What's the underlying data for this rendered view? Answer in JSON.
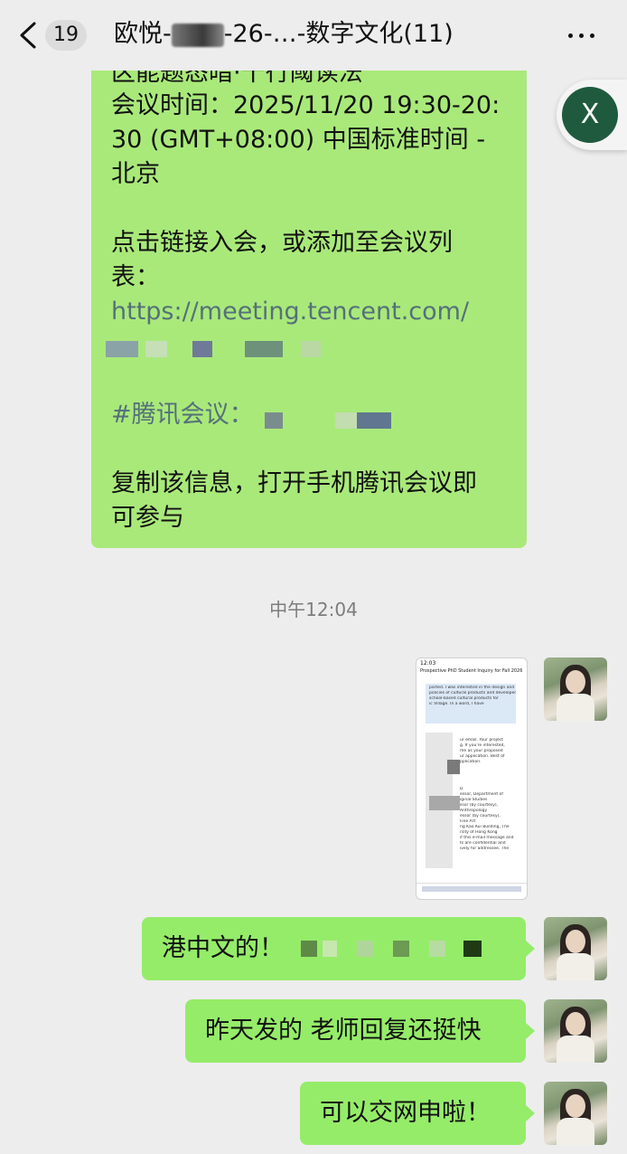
{
  "header": {
    "unread_count": "19",
    "title_prefix": "欧悦-",
    "title_suffix": "-26-…-数字文化(11)",
    "back_icon": "chevron-left-icon",
    "more_icon": "more-dots-icon"
  },
  "floating_close": {
    "label": "X"
  },
  "meeting_message": {
    "line_cut": "区能题态暗·十行阈读法",
    "line1": "会议时间：2025/11/20 19:30-20:",
    "line2": "30 (GMT+08:00) 中国标准时间 -",
    "line3": "北京",
    "line4": "点击链接入会，或添加至会议列",
    "line5": "表：",
    "link": "https://meeting.tencent.com/",
    "hashtag": "#腾讯会议：",
    "line6": "复制该信息，打开手机腾讯会议即",
    "line7": "可参与"
  },
  "timestamp": "中午12:04",
  "screenshot_thumb": {
    "status_time": "12:03",
    "mail_title": "Prospective PhD Student Inquiry for Fall 2026",
    "snippet_lines": [
      "parted. I was interested in the design and",
      "policies of cultural products and developed",
      "school-based cultural products for",
      "ic Village. In a word, I have",
      "ur email. Your project",
      "g. If you're interested,",
      "me as your proposed",
      "ur application. Best of",
      "pplication.",
      "D",
      "essor, Department of",
      "iginal Studies",
      "ssor (by courtesy),",
      "Anthropology",
      "essor (by courtesy),",
      "Fine Art",
      "ng Kao Kui Building, The",
      "rsity of Hong Kong",
      "if this e-mail message and",
      "ts are confidential and",
      "ively for addressee. The"
    ]
  },
  "messages": [
    {
      "text": "港中文的！"
    },
    {
      "text": "昨天发的 老师回复还挺快"
    },
    {
      "text": "可以交网申啦！"
    }
  ],
  "colors": {
    "bubble_green": "#95ec69",
    "background": "#ededed"
  }
}
